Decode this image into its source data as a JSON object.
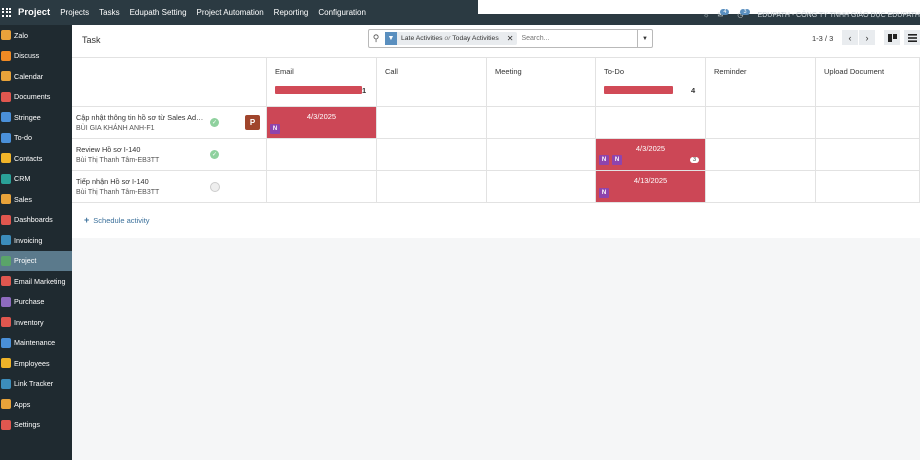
{
  "topbar": {
    "brand": "Project",
    "menu": [
      "Projects",
      "Tasks",
      "Edupath Setting",
      "Project Automation",
      "Reporting",
      "Configuration"
    ],
    "chat_badge": "4",
    "activity_badge": "3",
    "company": "EDUPATH - CÔNG TY TNHH GIÁO DỤC EDUPATH"
  },
  "sidebar": {
    "items": [
      {
        "label": "Zalo",
        "color": "#e9a23b"
      },
      {
        "label": "Discuss",
        "color": "#f08a24"
      },
      {
        "label": "Calendar",
        "color": "#e8a33a"
      },
      {
        "label": "Documents",
        "color": "#e0574f"
      },
      {
        "label": "Stringee",
        "color": "#4a90d9"
      },
      {
        "label": "To-do",
        "color": "#4a90d9"
      },
      {
        "label": "Contacts",
        "color": "#f0b429"
      },
      {
        "label": "CRM",
        "color": "#2aa198"
      },
      {
        "label": "Sales",
        "color": "#e8a33a"
      },
      {
        "label": "Dashboards",
        "color": "#e0574f"
      },
      {
        "label": "Invoicing",
        "color": "#3c8dbc"
      },
      {
        "label": "Project",
        "color": "#5aa469",
        "active": true
      },
      {
        "label": "Email Marketing",
        "color": "#e0574f"
      },
      {
        "label": "Purchase",
        "color": "#8e6bbf"
      },
      {
        "label": "Inventory",
        "color": "#e0574f"
      },
      {
        "label": "Maintenance",
        "color": "#4a90d9"
      },
      {
        "label": "Employees",
        "color": "#f0b429"
      },
      {
        "label": "Link Tracker",
        "color": "#3c8dbc"
      },
      {
        "label": "Apps",
        "color": "#e8a33a"
      },
      {
        "label": "Settings",
        "color": "#e0574f"
      }
    ]
  },
  "control_panel": {
    "title": "Task",
    "facet": {
      "part1": "Late Activities",
      "or": "or",
      "part2": "Today Activities"
    },
    "search_placeholder": "Search...",
    "pager": "1-3 / 3"
  },
  "columns": [
    {
      "name": "Email",
      "count": "1",
      "bar_fraction": 0.92
    },
    {
      "name": "Call"
    },
    {
      "name": "Meeting"
    },
    {
      "name": "To-Do",
      "count": "4",
      "bar_fraction": 0.73
    },
    {
      "name": "Reminder"
    },
    {
      "name": "Upload Document"
    }
  ],
  "tasks": [
    {
      "name": "Cập nhật thông tin hồ sơ từ Sales Admin",
      "user": "BÙI GIA KHÁNH ANH-F1",
      "status": "done",
      "avatar": "P",
      "avatar_color": "#a0452c"
    },
    {
      "name": "Review Hồ sơ I-140",
      "user": "Bùi Thị Thanh Tâm-EB3TT",
      "status": "done"
    },
    {
      "name": "Tiếp nhận Hồ sơ I-140",
      "user": "Bùi Thị Thanh Tâm-EB3TT",
      "status": "normal"
    }
  ],
  "activities": {
    "r0_email": {
      "date": "4/3/2025",
      "avatars": [
        "N"
      ]
    },
    "r1_todo": {
      "date": "4/3/2025",
      "avatars": [
        "N",
        "N"
      ],
      "count": "3"
    },
    "r2_todo": {
      "date": "4/13/2025",
      "avatars": [
        "N"
      ]
    }
  },
  "schedule_label": "Schedule activity"
}
